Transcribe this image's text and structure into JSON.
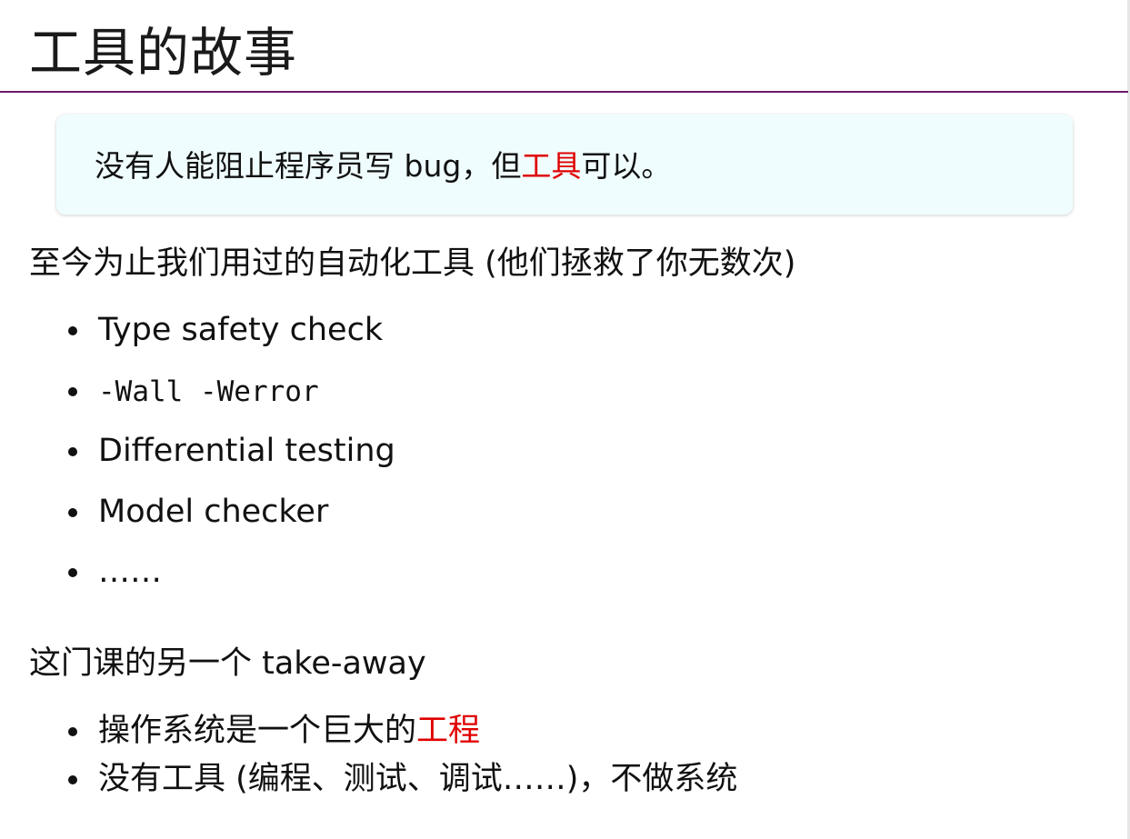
{
  "title": "工具的故事",
  "quote": {
    "part1": "没有人能阻止程序员写 ",
    "part2": "bug",
    "part3": "，但",
    "highlight": "工具",
    "part4": "可以。"
  },
  "section1": {
    "heading": "至今为止我们用过的自动化工具 (他们拯救了你无数次)",
    "items": [
      "Type safety check",
      "-Wall -Werror",
      "Differential testing",
      "Model checker",
      "……"
    ]
  },
  "section2": {
    "heading": "这门课的另一个 take-away",
    "item1": {
      "text": "操作系统是一个巨大的",
      "highlight": "工程"
    },
    "item2": "没有工具 (编程、测试、调试……)，不做系统"
  },
  "colors": {
    "accent_red": "#e00000",
    "rule_purple": "#6a1a6a",
    "quote_background": "#f0fdff"
  }
}
